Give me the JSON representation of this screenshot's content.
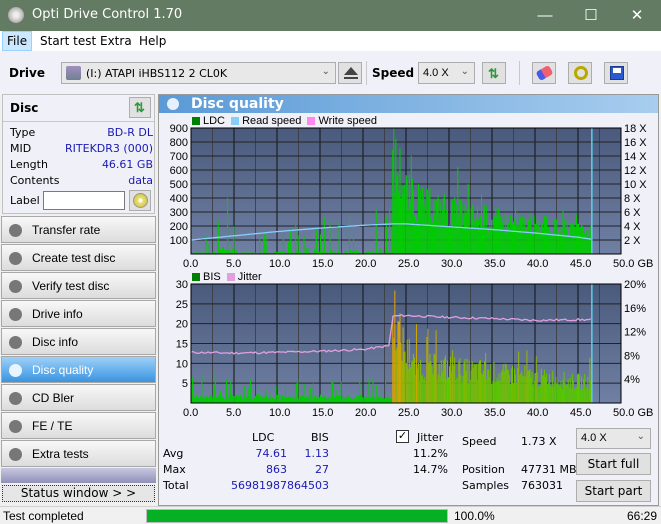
{
  "window": {
    "title": "Opti Drive Control 1.70",
    "minimize_glyph": "—",
    "maximize_glyph": "☐",
    "close_glyph": "✕"
  },
  "menu": {
    "items": [
      "File",
      "Start test",
      "Extra",
      "Help"
    ]
  },
  "toolbar": {
    "drive_label": "Drive",
    "drive_value": "(I:)  ATAPI iHBS112   2 CL0K",
    "speed_label": "Speed",
    "speed_value": "4.0 X",
    "icons": [
      "drive-icon",
      "eject-icon",
      "refresh-icon",
      "erase-icon",
      "settings-icon",
      "save-icon"
    ]
  },
  "disc": {
    "header": "Disc",
    "rows": [
      {
        "key": "Type",
        "value": "BD-R DL"
      },
      {
        "key": "MID",
        "value": "RITEKDR3 (000)"
      },
      {
        "key": "Length",
        "value": "46.61 GB"
      },
      {
        "key": "Contents",
        "value": "data"
      }
    ],
    "label_key": "Label",
    "label_value": ""
  },
  "nav": {
    "items": [
      {
        "label": "Transfer rate",
        "active": false
      },
      {
        "label": "Create test disc",
        "active": false
      },
      {
        "label": "Verify test disc",
        "active": false
      },
      {
        "label": "Drive info",
        "active": false
      },
      {
        "label": "Disc info",
        "active": false
      },
      {
        "label": "Disc quality",
        "active": true
      },
      {
        "label": "CD Bler",
        "active": false
      },
      {
        "label": "FE / TE",
        "active": false
      },
      {
        "label": "Extra tests",
        "active": false
      }
    ],
    "status_window": "Status window > >"
  },
  "panel": {
    "title": "Disc quality"
  },
  "chart_data": [
    {
      "type": "area",
      "title": "LDC / Read speed",
      "legend": [
        "LDC",
        "Read speed",
        "Write speed"
      ],
      "legend_colors": {
        "LDC": "#008000",
        "Read speed": "#87cefa",
        "Write speed": "#ff88ee"
      },
      "legend_placement": "top-left",
      "x_ticks": [
        "0.0",
        "5.0",
        "10.0",
        "15.0",
        "20.0",
        "25.0",
        "30.0",
        "35.0",
        "40.0",
        "45.0",
        "50.0 GB"
      ],
      "y_ticks": [
        "100",
        "200",
        "300",
        "400",
        "500",
        "600",
        "700",
        "800",
        "900"
      ],
      "y2_ticks": [
        "2 X",
        "4 X",
        "6 X",
        "8 X",
        "10 X",
        "12 X",
        "14 X",
        "16 X",
        "18 X"
      ],
      "xlim": [
        0,
        50
      ],
      "ylim": [
        0,
        900
      ],
      "y2lim": [
        0,
        18
      ],
      "grid": true,
      "end_marker_gb": 46.61,
      "series": [
        {
          "name": "LDC",
          "x": [
            0,
            1,
            2,
            3,
            4,
            5,
            6,
            7,
            8,
            9,
            10,
            11,
            12,
            13,
            14,
            15,
            16,
            17,
            18,
            19,
            20,
            21,
            22,
            23,
            23.5,
            24,
            24.5,
            25,
            26,
            27,
            28,
            29,
            30,
            31,
            32,
            33,
            34,
            35,
            36,
            37,
            38,
            39,
            40,
            41,
            42,
            43,
            44,
            45,
            46,
            46.6
          ],
          "values": [
            30,
            40,
            20,
            30,
            120,
            60,
            20,
            30,
            60,
            20,
            40,
            30,
            40,
            50,
            110,
            30,
            80,
            50,
            40,
            60,
            30,
            50,
            70,
            60,
            780,
            700,
            650,
            500,
            420,
            400,
            380,
            360,
            340,
            330,
            310,
            300,
            290,
            280,
            270,
            260,
            250,
            240,
            230,
            220,
            210,
            200,
            190,
            180,
            170,
            160
          ]
        },
        {
          "name": "Read speed",
          "x": [
            0,
            5,
            10,
            15,
            20,
            23.4,
            25,
            30,
            35,
            40,
            45,
            46.6
          ],
          "values": [
            2.0,
            2.6,
            3.2,
            3.7,
            4.1,
            4.3,
            4.3,
            3.9,
            3.5,
            3.0,
            2.4,
            2.1
          ]
        }
      ]
    },
    {
      "type": "area",
      "title": "BIS / Jitter",
      "legend": [
        "BIS",
        "Jitter"
      ],
      "legend_colors": {
        "BIS": "#008000",
        "Jitter": "#e0a0e0"
      },
      "legend_placement": "top-left",
      "x_ticks": [
        "0.0",
        "5.0",
        "10.0",
        "15.0",
        "20.0",
        "25.0",
        "30.0",
        "35.0",
        "40.0",
        "45.0",
        "50.0 GB"
      ],
      "y_ticks": [
        "5",
        "10",
        "15",
        "20",
        "25",
        "30"
      ],
      "y2_ticks": [
        "4%",
        "8%",
        "12%",
        "16%",
        "20%"
      ],
      "xlim": [
        0,
        50
      ],
      "ylim": [
        0,
        30
      ],
      "y2lim": [
        0,
        20
      ],
      "grid": true,
      "end_marker_gb": 46.61,
      "series": [
        {
          "name": "BIS",
          "x": [
            0,
            2,
            4,
            6,
            8,
            10,
            12,
            14,
            16,
            18,
            20,
            22,
            23,
            23.5,
            24,
            24.5,
            25,
            26,
            28,
            30,
            32,
            34,
            36,
            38,
            40,
            42,
            44,
            46,
            46.6
          ],
          "values": [
            2,
            2,
            3,
            2,
            2,
            2,
            3,
            2,
            3,
            2,
            2,
            2,
            2,
            27,
            20,
            17,
            14,
            10,
            10,
            10,
            9,
            9,
            8,
            8,
            7,
            7,
            6,
            6,
            6
          ]
        },
        {
          "name": "Jitter",
          "x": [
            0,
            5,
            10,
            15,
            20,
            23,
            23.5,
            25,
            30,
            35,
            40,
            45,
            46.6
          ],
          "values": [
            8.5,
            8.4,
            8.5,
            8.7,
            9.0,
            9.6,
            14.6,
            14.7,
            14.4,
            14.2,
            13.9,
            14.0,
            14.0
          ]
        }
      ]
    }
  ],
  "stats": {
    "col_ldc": "LDC",
    "col_bis": "BIS",
    "jitter_label": "Jitter",
    "jitter_checked": true,
    "rows": [
      {
        "label": "Avg",
        "ldc": "74.61",
        "bis": "1.13",
        "jitter": "11.2%"
      },
      {
        "label": "Max",
        "ldc": "863",
        "bis": "27",
        "jitter": "14.7%"
      },
      {
        "label": "Total",
        "ldc": "56981987",
        "bis": "864503",
        "jitter": ""
      }
    ],
    "speed_label": "Speed",
    "speed_value": "1.73 X",
    "position_label": "Position",
    "position_value": "47731 MB",
    "samples_label": "Samples",
    "samples_value": "763031",
    "speed_select": "4.0 X",
    "start_full": "Start full",
    "start_part": "Start part"
  },
  "statusbar": {
    "text": "Test completed",
    "progress_percent": 100.0,
    "progress_text": "100.0%",
    "time": "66:29"
  }
}
